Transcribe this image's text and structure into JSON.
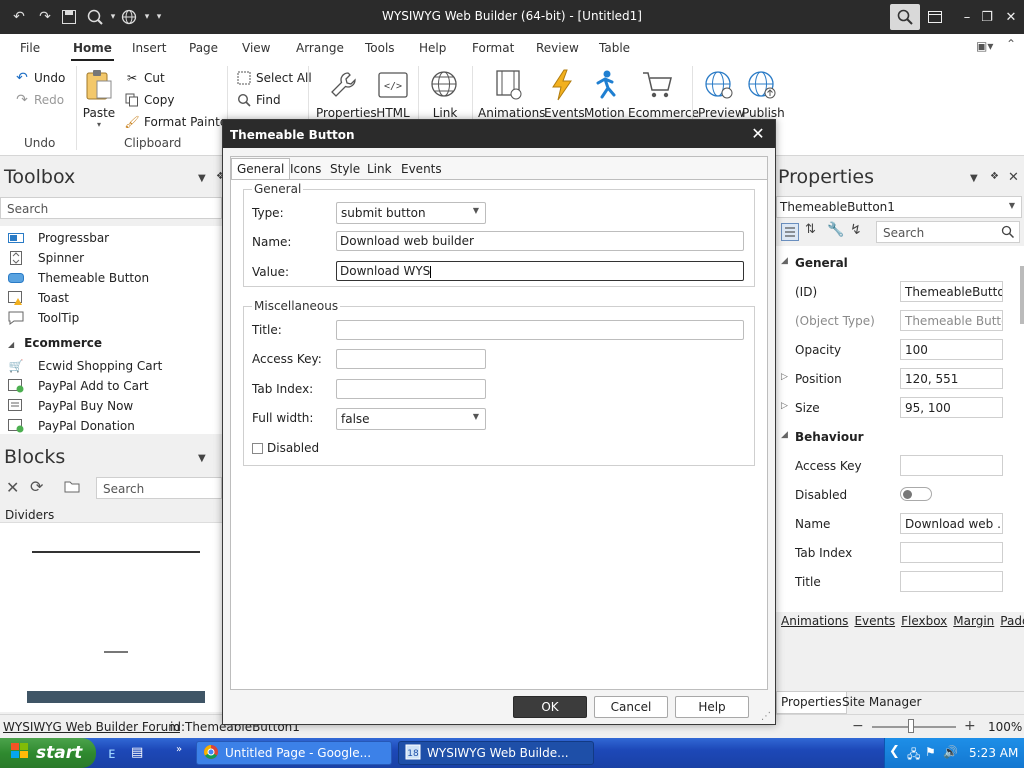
{
  "app": {
    "title": "WYSIWYG Web Builder (64-bit) - [Untitled1]"
  },
  "menu": {
    "tabs": [
      "File",
      "Home",
      "Insert",
      "Page",
      "View",
      "Arrange",
      "Tools",
      "Help",
      "Format",
      "Review",
      "Table"
    ]
  },
  "ribbon": {
    "undo": "Undo",
    "redo": "Redo",
    "undo_group": "Undo",
    "paste": "Paste",
    "cut": "Cut",
    "copy": "Copy",
    "format_painter": "Format Painter",
    "clipboard_group": "Clipboard",
    "select_all": "Select All",
    "find": "Find",
    "big_buttons": [
      "Properties",
      "HTML",
      "Link",
      "Animations",
      "Events",
      "Motion",
      "Ecommerce",
      "Preview",
      "Publish"
    ]
  },
  "toolbox": {
    "title": "Toolbox",
    "search_placeholder": "Search",
    "items": [
      "Progressbar",
      "Spinner",
      "Themeable Button",
      "Toast",
      "ToolTip"
    ],
    "ecommerce_category": "Ecommerce",
    "ecommerce_items": [
      "Ecwid Shopping Cart",
      "PayPal Add to Cart",
      "PayPal Buy Now",
      "PayPal Donation"
    ]
  },
  "blocks": {
    "title": "Blocks",
    "search_placeholder": "Search",
    "category": "Dividers"
  },
  "properties": {
    "title": "Properties",
    "object": "ThemeableButton1",
    "search_placeholder": "Search",
    "general_section": "General",
    "behaviour_section": "Behaviour",
    "rows": {
      "id_label": "(ID)",
      "id_value": "ThemeableButto...",
      "type_label": "(Object Type)",
      "type_value": "Themeable Button",
      "opacity_label": "Opacity",
      "opacity_value": "100",
      "position_label": "Position",
      "position_value": "120, 551",
      "size_label": "Size",
      "size_value": "95, 100",
      "accesskey_label": "Access Key",
      "accesskey_value": "",
      "disabled_label": "Disabled",
      "name_label": "Name",
      "name_value": "Download web ...",
      "tabindex_label": "Tab Index",
      "tabindex_value": "",
      "title_label": "Title",
      "title_value": ""
    },
    "links": [
      "Animations",
      "Events",
      "Flexbox",
      "Margin",
      "Padding"
    ],
    "bottom_tabs": [
      "Properties",
      "Site Manager"
    ]
  },
  "statusbar": {
    "forum": "WYSIWYG Web Builder Forum",
    "id": "id:ThemeableButton1",
    "zoom": "100%"
  },
  "taskbar": {
    "start": "start",
    "items": [
      "Untitled Page - Google...",
      "WYSIWYG Web Builde..."
    ],
    "time": "5:23 AM"
  },
  "dialog": {
    "title": "Themeable Button",
    "tabs": [
      "General",
      "Icons",
      "Style",
      "Link",
      "Events"
    ],
    "general_legend": "General",
    "type_label": "Type:",
    "type_value": "submit button",
    "name_label": "Name:",
    "name_value": "Download web builder",
    "value_label": "Value:",
    "value_value": "Download WYS",
    "misc_legend": "Miscellaneous",
    "title_label": "Title:",
    "title_value": "",
    "accesskey_label": "Access Key:",
    "accesskey_value": "",
    "tabindex_label": "Tab Index:",
    "tabindex_value": "",
    "fullwidth_label": "Full width:",
    "fullwidth_value": "false",
    "disabled_label": "Disabled",
    "ok": "OK",
    "cancel": "Cancel",
    "help": "Help"
  }
}
